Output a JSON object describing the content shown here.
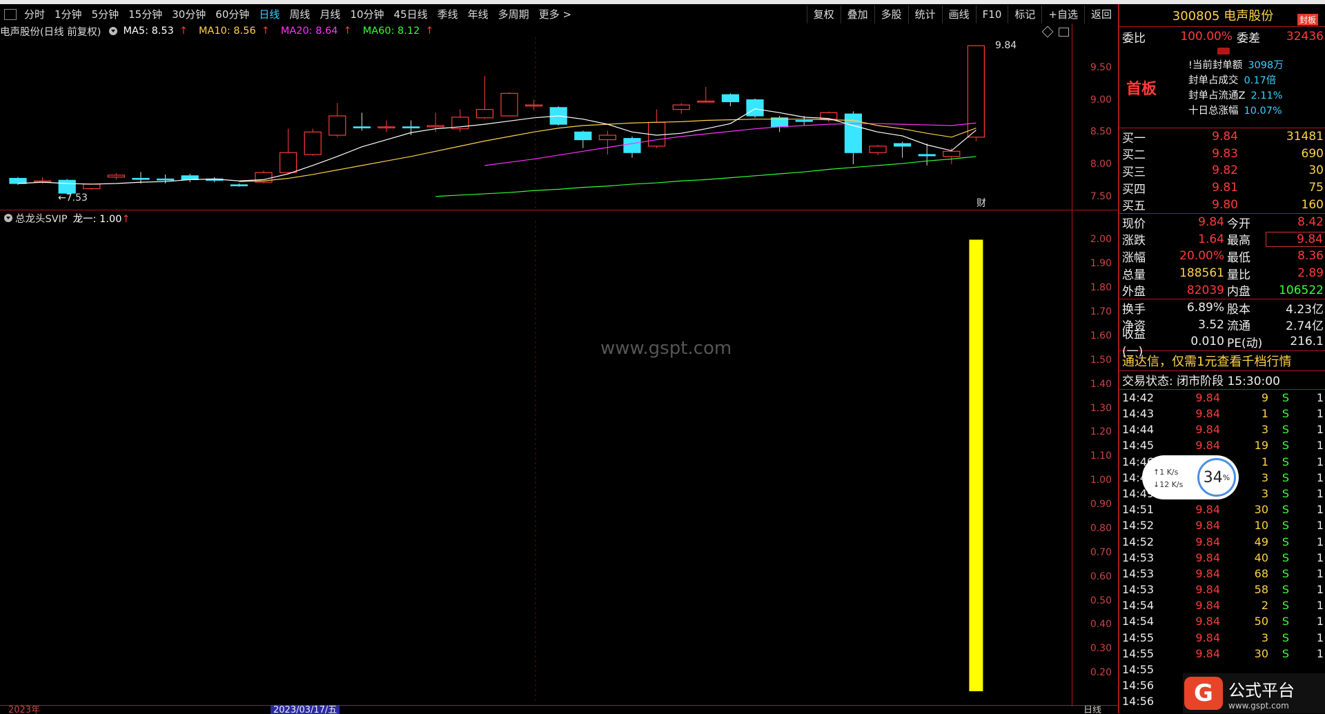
{
  "toolbar": {
    "periods": [
      "分时",
      "1分钟",
      "5分钟",
      "15分钟",
      "30分钟",
      "60分钟",
      "日线",
      "周线",
      "月线",
      "10分钟",
      "45日线",
      "季线",
      "年线",
      "多周期",
      "更多 >"
    ],
    "active_index": 6,
    "right_items": [
      "复权",
      "叠加",
      "多股",
      "统计",
      "画线",
      "F10",
      "标记",
      "+自选",
      "返回"
    ]
  },
  "main_chart": {
    "indicator_label": "电声股份(日线 前复权)",
    "ma5": "MA5: 8.53",
    "ma10": "MA10: 8.56",
    "ma20": "MA20: 8.64",
    "ma60": "MA60: 8.12",
    "up_arrow": "↑",
    "high_label": "9.84",
    "low_label": "7.53",
    "fin_label": "财",
    "price_ticks": [
      "9.50",
      "9.00",
      "8.50",
      "8.00",
      "7.50"
    ],
    "colors": {
      "ma5": "#ffffff",
      "ma10": "#ffd24a",
      "ma20": "#ff33ff",
      "ma60": "#33ff33",
      "up": "#ff3b3b",
      "down": "#39e6ff"
    }
  },
  "sub_chart": {
    "indicator_label": "总龙头SVIP",
    "value_label": "龙一: 1.00",
    "up_arrow": "↑",
    "ticks": [
      "2.00",
      "1.90",
      "1.80",
      "1.70",
      "1.60",
      "1.50",
      "1.40",
      "1.30",
      "1.20",
      "1.10",
      "1.00",
      "0.90",
      "0.80",
      "0.70",
      "0.60",
      "0.50",
      "0.40",
      "0.30",
      "0.20"
    ],
    "bar_value": 1.0,
    "bar_color": "#ffff00"
  },
  "watermark": "www.gspt.com",
  "footer": {
    "left": "2023年",
    "mid": "2023/03/17/五",
    "right": "日线"
  },
  "panel": {
    "title": "300805 电声股份",
    "badge": "封板",
    "weibi_label": "委比",
    "weibi_value": "100.00%",
    "weicha_label": "委差",
    "weicha_value": "32436",
    "firstboard": "首板",
    "fb_lines": [
      {
        "label": "!当前封单额",
        "value": "3098万"
      },
      {
        "label": "封单占成交",
        "value": "0.17倍"
      },
      {
        "label": "封单占流通Z",
        "value": "2.11%"
      },
      {
        "label": "十日总涨幅",
        "value": "10.07%"
      }
    ],
    "bids": [
      {
        "label": "买一",
        "price": "9.84",
        "vol": "31481"
      },
      {
        "label": "买二",
        "price": "9.83",
        "vol": "690"
      },
      {
        "label": "买三",
        "price": "9.82",
        "vol": "30"
      },
      {
        "label": "买四",
        "price": "9.81",
        "vol": "75"
      },
      {
        "label": "买五",
        "price": "9.80",
        "vol": "160"
      }
    ],
    "quote": [
      {
        "l1": "现价",
        "v1": "9.84",
        "l2": "今开",
        "v2": "8.42"
      },
      {
        "l1": "涨跌",
        "v1": "1.64",
        "l2": "最高",
        "v2": "9.84"
      },
      {
        "l1": "涨幅",
        "v1": "20.00%",
        "l2": "最低",
        "v2": "8.36"
      },
      {
        "l1": "总量",
        "v1": "188561",
        "l2": "量比",
        "v2": "2.89"
      },
      {
        "l1": "外盘",
        "v1": "82039",
        "l2": "内盘",
        "v2": "106522"
      }
    ],
    "fund": [
      {
        "l1": "换手",
        "v1": "6.89%",
        "l2": "股本",
        "v2": "4.23亿"
      },
      {
        "l1": "净资",
        "v1": "3.52",
        "l2": "流通",
        "v2": "2.74亿"
      },
      {
        "l1": "收益(一)",
        "v1": "0.010",
        "l2": "PE(动)",
        "v2": "216.1"
      }
    ],
    "notice": "通达信，仅需1元查看千档行情",
    "status": "交易状态: 闭市阶段 15:30:00",
    "ticks": [
      {
        "t": "14:42",
        "p": "9.84",
        "v": "9",
        "s": "S",
        "n": "1"
      },
      {
        "t": "14:43",
        "p": "9.84",
        "v": "1",
        "s": "S",
        "n": "1"
      },
      {
        "t": "14:44",
        "p": "9.84",
        "v": "3",
        "s": "S",
        "n": "1"
      },
      {
        "t": "14:45",
        "p": "9.84",
        "v": "19",
        "s": "S",
        "n": "1"
      },
      {
        "t": "14:46",
        "p": "9.84",
        "v": "1",
        "s": "S",
        "n": "1"
      },
      {
        "t": "14:47",
        "p": "9.84",
        "v": "3",
        "s": "S",
        "n": "1"
      },
      {
        "t": "14:49",
        "p": "9.84",
        "v": "3",
        "s": "S",
        "n": "1"
      },
      {
        "t": "14:51",
        "p": "9.84",
        "v": "30",
        "s": "S",
        "n": "1"
      },
      {
        "t": "14:52",
        "p": "9.84",
        "v": "10",
        "s": "S",
        "n": "1"
      },
      {
        "t": "14:52",
        "p": "9.84",
        "v": "49",
        "s": "S",
        "n": "1"
      },
      {
        "t": "14:53",
        "p": "9.84",
        "v": "40",
        "s": "S",
        "n": "1"
      },
      {
        "t": "14:53",
        "p": "9.84",
        "v": "68",
        "s": "S",
        "n": "1"
      },
      {
        "t": "14:53",
        "p": "9.84",
        "v": "58",
        "s": "S",
        "n": "1"
      },
      {
        "t": "14:54",
        "p": "9.84",
        "v": "2",
        "s": "S",
        "n": "1"
      },
      {
        "t": "14:54",
        "p": "9.84",
        "v": "50",
        "s": "S",
        "n": "1"
      },
      {
        "t": "14:55",
        "p": "9.84",
        "v": "3",
        "s": "S",
        "n": "1"
      },
      {
        "t": "14:55",
        "p": "9.84",
        "v": "30",
        "s": "S",
        "n": "1"
      },
      {
        "t": "14:55",
        "p": "",
        "v": "",
        "s": "",
        "n": ""
      },
      {
        "t": "14:56",
        "p": "",
        "v": "",
        "s": "",
        "n": ""
      },
      {
        "t": "14:56",
        "p": "",
        "v": "",
        "s": "",
        "n": ""
      }
    ]
  },
  "speed_widget": {
    "up": "↑1 K/s",
    "down": "↓12 K/s",
    "percent": "34",
    "percent_unit": "%"
  },
  "logo": {
    "mark": "G",
    "line1": "公式平台",
    "line2": "www.gspt.com"
  },
  "chart_data": {
    "type": "candlestick",
    "ylim": [
      7.4,
      9.95
    ],
    "candles": [
      {
        "o": 7.78,
        "c": 7.7,
        "h": 7.8,
        "l": 7.68
      },
      {
        "o": 7.73,
        "c": 7.74,
        "h": 7.8,
        "l": 7.7
      },
      {
        "o": 7.75,
        "c": 7.55,
        "h": 7.77,
        "l": 7.53
      },
      {
        "o": 7.62,
        "c": 7.69,
        "h": 7.7,
        "l": 7.6
      },
      {
        "o": 7.8,
        "c": 7.83,
        "h": 7.86,
        "l": 7.76
      },
      {
        "o": 7.78,
        "c": 7.77,
        "h": 7.88,
        "l": 7.7
      },
      {
        "o": 7.77,
        "c": 7.76,
        "h": 7.84,
        "l": 7.7
      },
      {
        "o": 7.82,
        "c": 7.76,
        "h": 7.85,
        "l": 7.72
      },
      {
        "o": 7.77,
        "c": 7.75,
        "h": 7.8,
        "l": 7.72
      },
      {
        "o": 7.68,
        "c": 7.67,
        "h": 7.7,
        "l": 7.65
      },
      {
        "o": 7.72,
        "c": 7.87,
        "h": 7.9,
        "l": 7.7
      },
      {
        "o": 7.87,
        "c": 8.18,
        "h": 8.55,
        "l": 7.86
      },
      {
        "o": 8.15,
        "c": 8.5,
        "h": 8.55,
        "l": 8.13
      },
      {
        "o": 8.45,
        "c": 8.75,
        "h": 8.95,
        "l": 8.42
      },
      {
        "o": 8.58,
        "c": 8.57,
        "h": 8.8,
        "l": 8.52
      },
      {
        "o": 8.57,
        "c": 8.58,
        "h": 8.68,
        "l": 8.5
      },
      {
        "o": 8.58,
        "c": 8.57,
        "h": 8.68,
        "l": 8.45
      },
      {
        "o": 8.58,
        "c": 8.6,
        "h": 8.8,
        "l": 8.5
      },
      {
        "o": 8.55,
        "c": 8.73,
        "h": 8.85,
        "l": 8.5
      },
      {
        "o": 8.72,
        "c": 8.85,
        "h": 9.37,
        "l": 8.7
      },
      {
        "o": 8.75,
        "c": 9.1,
        "h": 9.12,
        "l": 8.74
      },
      {
        "o": 8.92,
        "c": 8.92,
        "h": 9.0,
        "l": 8.84
      },
      {
        "o": 8.88,
        "c": 8.62,
        "h": 8.9,
        "l": 8.6
      },
      {
        "o": 8.5,
        "c": 8.38,
        "h": 8.52,
        "l": 8.25
      },
      {
        "o": 8.38,
        "c": 8.45,
        "h": 8.52,
        "l": 8.15
      },
      {
        "o": 8.4,
        "c": 8.18,
        "h": 8.43,
        "l": 8.1
      },
      {
        "o": 8.28,
        "c": 8.65,
        "h": 8.85,
        "l": 8.25
      },
      {
        "o": 8.85,
        "c": 8.92,
        "h": 8.95,
        "l": 8.78
      },
      {
        "o": 8.98,
        "c": 8.98,
        "h": 9.2,
        "l": 8.95
      },
      {
        "o": 9.08,
        "c": 8.97,
        "h": 9.1,
        "l": 8.9
      },
      {
        "o": 9.0,
        "c": 8.75,
        "h": 9.02,
        "l": 8.72
      },
      {
        "o": 8.72,
        "c": 8.58,
        "h": 8.75,
        "l": 8.5
      },
      {
        "o": 8.68,
        "c": 8.67,
        "h": 8.75,
        "l": 8.6
      },
      {
        "o": 8.7,
        "c": 8.8,
        "h": 8.82,
        "l": 8.65
      },
      {
        "o": 8.78,
        "c": 8.18,
        "h": 8.82,
        "l": 8.0
      },
      {
        "o": 8.18,
        "c": 8.28,
        "h": 8.3,
        "l": 8.14
      },
      {
        "o": 8.32,
        "c": 8.28,
        "h": 8.35,
        "l": 8.1
      },
      {
        "o": 8.15,
        "c": 8.13,
        "h": 8.32,
        "l": 7.98
      },
      {
        "o": 8.12,
        "c": 8.2,
        "h": 8.25,
        "l": 8.0
      },
      {
        "o": 8.42,
        "c": 9.84,
        "h": 9.84,
        "l": 8.36
      }
    ],
    "ma5": [
      7.7,
      7.72,
      7.7,
      7.69,
      7.7,
      7.72,
      7.73,
      7.76,
      7.77,
      7.74,
      7.76,
      7.85,
      7.98,
      8.12,
      8.27,
      8.38,
      8.49,
      8.55,
      8.58,
      8.62,
      8.67,
      8.72,
      8.75,
      8.7,
      8.62,
      8.5,
      8.45,
      8.48,
      8.55,
      8.63,
      8.86,
      8.8,
      8.73,
      8.71,
      8.6,
      8.5,
      8.44,
      8.3,
      8.21,
      8.53
    ],
    "ma10": [
      null,
      null,
      null,
      null,
      null,
      null,
      null,
      null,
      null,
      7.73,
      7.74,
      7.78,
      7.84,
      7.91,
      7.98,
      8.05,
      8.12,
      8.2,
      8.28,
      8.36,
      8.43,
      8.5,
      8.56,
      8.6,
      8.62,
      8.64,
      8.65,
      8.66,
      8.68,
      8.69,
      8.7,
      8.7,
      8.7,
      8.69,
      8.68,
      8.6,
      8.55,
      8.48,
      8.42,
      8.56
    ],
    "ma20": [
      null,
      null,
      null,
      null,
      null,
      null,
      null,
      null,
      null,
      null,
      null,
      null,
      null,
      null,
      null,
      null,
      null,
      null,
      null,
      7.98,
      8.03,
      8.08,
      8.14,
      8.2,
      8.26,
      8.32,
      8.38,
      8.43,
      8.47,
      8.51,
      8.55,
      8.58,
      8.6,
      8.62,
      8.63,
      8.63,
      8.62,
      8.61,
      8.6,
      8.64
    ],
    "ma60": [
      null,
      null,
      null,
      null,
      null,
      null,
      null,
      null,
      null,
      null,
      null,
      null,
      null,
      null,
      null,
      null,
      null,
      7.5,
      7.52,
      7.54,
      7.56,
      7.59,
      7.61,
      7.64,
      7.66,
      7.69,
      7.71,
      7.74,
      7.76,
      7.79,
      7.82,
      7.85,
      7.88,
      7.92,
      7.95,
      7.98,
      8.01,
      8.05,
      8.08,
      8.12
    ]
  }
}
